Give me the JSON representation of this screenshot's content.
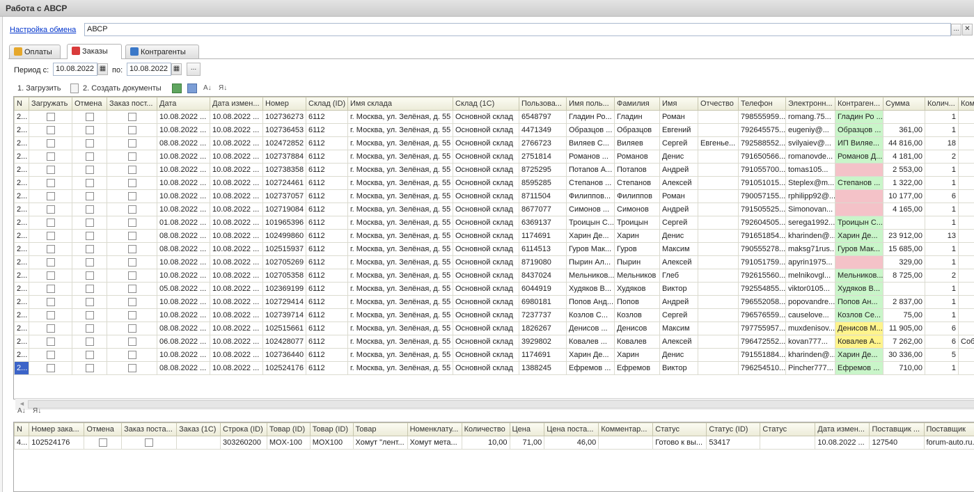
{
  "window": {
    "title": "Работа с АВСР"
  },
  "exchange": {
    "link_label": "Настройка обмена",
    "value": "АВСР",
    "more_btn": "...",
    "clear_btn": "✕"
  },
  "tabs": [
    {
      "label": "Оплаты",
      "icon": "payments-icon"
    },
    {
      "label": "Заказы",
      "icon": "orders-icon"
    },
    {
      "label": "Контрагенты",
      "icon": "contractors-icon"
    }
  ],
  "period": {
    "label": "Период с:",
    "from": "10.08.2022",
    "to_label": "по:",
    "to": "10.08.2022",
    "more": "..."
  },
  "toolbar": {
    "load": "1. Загрузить",
    "create_docs": "2. Создать документы"
  },
  "orders": {
    "columns": [
      "N",
      "Загружать",
      "Отмена",
      "Заказ пост...",
      "Дата",
      "Дата измен...",
      "Номер",
      "Склад (ID)",
      "Имя склада",
      "Склад (1С)",
      "Пользова...",
      "Имя поль...",
      "Фамилия",
      "Имя",
      "Отчество",
      "Телефон",
      "Электронн...",
      "Контраген...",
      "Сумма",
      "Колич...",
      "Ком"
    ],
    "rows": [
      [
        "2...",
        "10.08.2022 ...",
        "10.08.2022 ...",
        "102736273",
        "6112",
        "г. Москва, ул. Зелёная, д. 55",
        "Основной склад",
        "6548797",
        "Гладин Ро...",
        "Гладин",
        "Роман",
        "",
        "798555959...",
        "romang.75...",
        "Гладин Ро ...",
        "",
        "1",
        ""
      ],
      [
        "2...",
        "10.08.2022 ...",
        "10.08.2022 ...",
        "102736453",
        "6112",
        "г. Москва, ул. Зелёная, д. 55",
        "Основной склад",
        "4471349",
        "Образцов ...",
        "Образцов",
        "Евгений",
        "",
        "792645575...",
        "eugeniy@...",
        "Образцов ...",
        "361,00",
        "1",
        ""
      ],
      [
        "2...",
        "08.08.2022 ...",
        "10.08.2022 ...",
        "102472852",
        "6112",
        "г. Москва, ул. Зелёная, д. 55",
        "Основной склад",
        "2766723",
        "Виляев С...",
        "Виляев",
        "Сергей",
        "Евгенье...",
        "792588552...",
        "svilyaiev@...",
        "ИП Виляе...",
        "44 816,00",
        "18",
        ""
      ],
      [
        "2...",
        "10.08.2022 ...",
        "10.08.2022 ...",
        "102737884",
        "6112",
        "г. Москва, ул. Зелёная, д. 55",
        "Основной склад",
        "2751814",
        "Романов ...",
        "Романов",
        "Денис",
        "",
        "791650566...",
        "romanovde...",
        "Романов Д...",
        "4 181,00",
        "2",
        ""
      ],
      [
        "2...",
        "10.08.2022 ...",
        "10.08.2022 ...",
        "102738358",
        "6112",
        "г. Москва, ул. Зелёная, д. 55",
        "Основной склад",
        "8725295",
        "Потапов А...",
        "Потапов",
        "Андрей",
        "",
        "791055700...",
        "tomas105...",
        "",
        "2 553,00",
        "1",
        ""
      ],
      [
        "2...",
        "10.08.2022 ...",
        "10.08.2022 ...",
        "102724461",
        "6112",
        "г. Москва, ул. Зелёная, д. 55",
        "Основной склад",
        "8595285",
        "Степанов ...",
        "Степанов",
        "Алексей",
        "",
        "791051015...",
        "Steplex@m...",
        "Степанов ...",
        "1 322,00",
        "1",
        ""
      ],
      [
        "2...",
        "10.08.2022 ...",
        "10.08.2022 ...",
        "102737057",
        "6112",
        "г. Москва, ул. Зелёная, д. 55",
        "Основной склад",
        "8711504",
        "Филиппов...",
        "Филиппов",
        "Роман",
        "",
        "790057155...",
        "rphilipp92@...",
        "",
        "10 177,00",
        "6",
        ""
      ],
      [
        "2...",
        "10.08.2022 ...",
        "10.08.2022 ...",
        "102719084",
        "6112",
        "г. Москва, ул. Зелёная, д. 55",
        "Основной склад",
        "8677077",
        "Симонов ...",
        "Симонов",
        "Андрей",
        "",
        "791505525...",
        "Simonovan...",
        "",
        "4 165,00",
        "1",
        ""
      ],
      [
        "2...",
        "01.08.2022 ...",
        "10.08.2022 ...",
        "101965396",
        "6112",
        "г. Москва, ул. Зелёная, д. 55",
        "Основной склад",
        "6369137",
        "Троицын С...",
        "Троицын",
        "Сергей",
        "",
        "792604505...",
        "serega1992...",
        "Троицын С...",
        "",
        "1",
        ""
      ],
      [
        "2...",
        "08.08.2022 ...",
        "10.08.2022 ...",
        "102499860",
        "6112",
        "г. Москва, ул. Зелёная, д. 55",
        "Основной склад",
        "1174691",
        "Харин Де...",
        "Харин",
        "Денис",
        "",
        "791651854...",
        "kharinden@...",
        "Харин Де...",
        "23 912,00",
        "13",
        ""
      ],
      [
        "2...",
        "08.08.2022 ...",
        "10.08.2022 ...",
        "102515937",
        "6112",
        "г. Москва, ул. Зелёная, д. 55",
        "Основной склад",
        "6114513",
        "Гуров Мак...",
        "Гуров",
        "Максим",
        "",
        "790555278...",
        "maksg71rus...",
        "Гуров Мак...",
        "15 685,00",
        "1",
        ""
      ],
      [
        "2...",
        "10.08.2022 ...",
        "10.08.2022 ...",
        "102705269",
        "6112",
        "г. Москва, ул. Зелёная, д. 55",
        "Основной склад",
        "8719080",
        "Пырин Ал...",
        "Пырин",
        "Алексей",
        "",
        "791051759...",
        "apyrin1975...",
        "",
        "329,00",
        "1",
        ""
      ],
      [
        "2...",
        "10.08.2022 ...",
        "10.08.2022 ...",
        "102705358",
        "6112",
        "г. Москва, ул. Зелёная, д. 55",
        "Основной склад",
        "8437024",
        "Мельников...",
        "Мельников",
        "Глеб",
        "",
        "792615560...",
        "melnikovgl...",
        "Мельников...",
        "8 725,00",
        "2",
        ""
      ],
      [
        "2...",
        "05.08.2022 ...",
        "10.08.2022 ...",
        "102369199",
        "6112",
        "г. Москва, ул. Зелёная, д. 55",
        "Основной склад",
        "6044919",
        "Худяков В...",
        "Худяков",
        "Виктор",
        "",
        "792554855...",
        "viktor0105...",
        "Худяков В...",
        "",
        "1",
        ""
      ],
      [
        "2...",
        "10.08.2022 ...",
        "10.08.2022 ...",
        "102729414",
        "6112",
        "г. Москва, ул. Зелёная, д. 55",
        "Основной склад",
        "6980181",
        "Попов Анд...",
        "Попов",
        "Андрей",
        "",
        "796552058...",
        "popovandre...",
        "Попов Ан...",
        "2 837,00",
        "1",
        ""
      ],
      [
        "2...",
        "10.08.2022 ...",
        "10.08.2022 ...",
        "102739714",
        "6112",
        "г. Москва, ул. Зелёная, д. 55",
        "Основной склад",
        "7237737",
        "Козлов С...",
        "Козлов",
        "Сергей",
        "",
        "796576559...",
        "causelove...",
        "Козлов Се...",
        "75,00",
        "1",
        ""
      ],
      [
        "2...",
        "08.08.2022 ...",
        "10.08.2022 ...",
        "102515661",
        "6112",
        "г. Москва, ул. Зелёная, д. 55",
        "Основной склад",
        "1826267",
        "Денисов ...",
        "Денисов",
        "Максим",
        "",
        "797755957...",
        "muxdenisov...",
        "Денисов М...",
        "11 905,00",
        "6",
        ""
      ],
      [
        "2...",
        "06.08.2022 ...",
        "10.08.2022 ...",
        "102428077",
        "6112",
        "г. Москва, ул. Зелёная, д. 55",
        "Основной склад",
        "3929802",
        "Ковалев ...",
        "Ковалев",
        "Алексей",
        "",
        "796472552...",
        "kovan777...",
        "Ковалев А...",
        "7 262,00",
        "6",
        "Соб"
      ],
      [
        "2...",
        "10.08.2022 ...",
        "10.08.2022 ...",
        "102736440",
        "6112",
        "г. Москва, ул. Зелёная, д. 55",
        "Основной склад",
        "1174691",
        "Харин Де...",
        "Харин",
        "Денис",
        "",
        "791551884...",
        "kharinden@...",
        "Харин Де...",
        "30 336,00",
        "5",
        ""
      ],
      [
        "2...",
        "08.08.2022 ...",
        "10.08.2022 ...",
        "102524176",
        "6112",
        "г. Москва, ул. Зелёная, д. 55",
        "Основной склад",
        "1388245",
        "Ефремов ...",
        "Ефремов",
        "Виктор",
        "",
        "796254510...",
        "Pincher777...",
        "Ефремов ...",
        "710,00",
        "1",
        ""
      ]
    ],
    "contractor_colors": [
      "green",
      "green",
      "green",
      "green",
      "pink",
      "green",
      "pink",
      "pink",
      "green",
      "green",
      "green",
      "pink",
      "green",
      "green",
      "green",
      "green",
      "yellow",
      "yellow",
      "green",
      "green"
    ],
    "selected_row": 19,
    "status_colors": {
      "green": "#c9f5c9",
      "pink": "#f4c2c8",
      "yellow": "#fff48c"
    }
  },
  "items": {
    "columns": [
      "N",
      "Номер зака...",
      "Отмена",
      "Заказ поста...",
      "Заказ (1С)",
      "Строка (ID)",
      "Товар (ID)",
      "Товар (ID)",
      "Товар",
      "Номенклату...",
      "Количество",
      "Цена",
      "Цена поста...",
      "Комментар...",
      "Статус",
      "Статус (ID)",
      "Статус",
      "Дата измен...",
      "Поставщик ...",
      "Поставщик",
      "П"
    ],
    "rows": [
      [
        "4...",
        "102524176",
        "",
        "303260200",
        "MOX-100",
        "MOX100",
        "Хомут \"лент...",
        "Хомут мета...",
        "10,00",
        "71,00",
        "46,00",
        "",
        "Готово к вы...",
        "53417",
        "",
        "10.08.2022 ...",
        "127540",
        "forum-auto.ru..."
      ]
    ]
  }
}
